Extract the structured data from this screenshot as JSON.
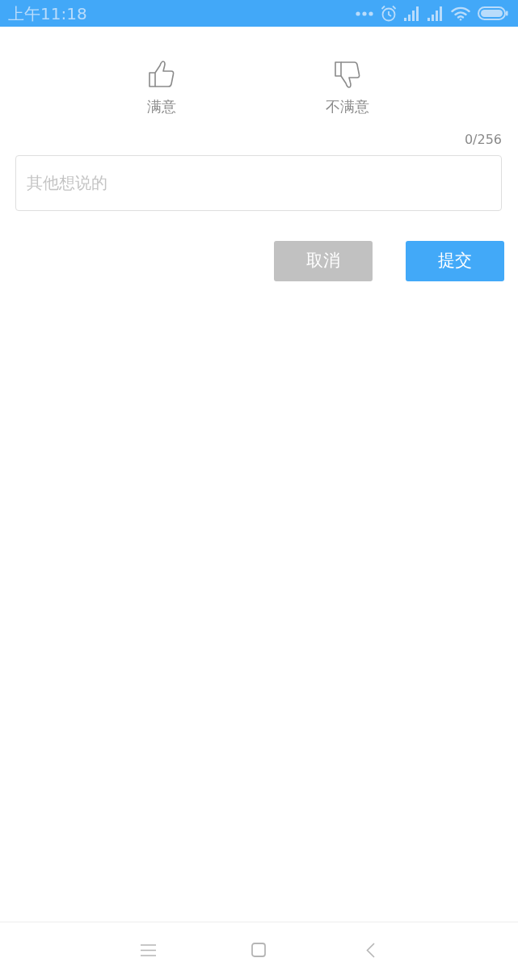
{
  "status_bar": {
    "time": "上午11:18"
  },
  "ratings": [
    {
      "kind": "like",
      "label": "满意",
      "selected": false
    },
    {
      "kind": "dislike",
      "label": "不满意",
      "selected": false
    }
  ],
  "comment": {
    "counter": "0/256",
    "placeholder": "其他想说的"
  },
  "buttons": [
    {
      "kind": "cancel",
      "label": "取消"
    },
    {
      "kind": "submit",
      "label": "提交"
    }
  ]
}
